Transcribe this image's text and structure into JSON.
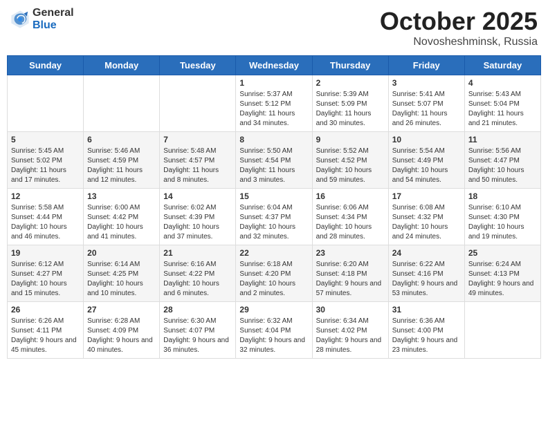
{
  "header": {
    "logo_general": "General",
    "logo_blue": "Blue",
    "month": "October 2025",
    "location": "Novosheshminsk, Russia"
  },
  "weekdays": [
    "Sunday",
    "Monday",
    "Tuesday",
    "Wednesday",
    "Thursday",
    "Friday",
    "Saturday"
  ],
  "weeks": [
    [
      {
        "day": "",
        "info": ""
      },
      {
        "day": "",
        "info": ""
      },
      {
        "day": "",
        "info": ""
      },
      {
        "day": "1",
        "info": "Sunrise: 5:37 AM\nSunset: 5:12 PM\nDaylight: 11 hours\nand 34 minutes."
      },
      {
        "day": "2",
        "info": "Sunrise: 5:39 AM\nSunset: 5:09 PM\nDaylight: 11 hours\nand 30 minutes."
      },
      {
        "day": "3",
        "info": "Sunrise: 5:41 AM\nSunset: 5:07 PM\nDaylight: 11 hours\nand 26 minutes."
      },
      {
        "day": "4",
        "info": "Sunrise: 5:43 AM\nSunset: 5:04 PM\nDaylight: 11 hours\nand 21 minutes."
      }
    ],
    [
      {
        "day": "5",
        "info": "Sunrise: 5:45 AM\nSunset: 5:02 PM\nDaylight: 11 hours\nand 17 minutes."
      },
      {
        "day": "6",
        "info": "Sunrise: 5:46 AM\nSunset: 4:59 PM\nDaylight: 11 hours\nand 12 minutes."
      },
      {
        "day": "7",
        "info": "Sunrise: 5:48 AM\nSunset: 4:57 PM\nDaylight: 11 hours\nand 8 minutes."
      },
      {
        "day": "8",
        "info": "Sunrise: 5:50 AM\nSunset: 4:54 PM\nDaylight: 11 hours\nand 3 minutes."
      },
      {
        "day": "9",
        "info": "Sunrise: 5:52 AM\nSunset: 4:52 PM\nDaylight: 10 hours\nand 59 minutes."
      },
      {
        "day": "10",
        "info": "Sunrise: 5:54 AM\nSunset: 4:49 PM\nDaylight: 10 hours\nand 54 minutes."
      },
      {
        "day": "11",
        "info": "Sunrise: 5:56 AM\nSunset: 4:47 PM\nDaylight: 10 hours\nand 50 minutes."
      }
    ],
    [
      {
        "day": "12",
        "info": "Sunrise: 5:58 AM\nSunset: 4:44 PM\nDaylight: 10 hours\nand 46 minutes."
      },
      {
        "day": "13",
        "info": "Sunrise: 6:00 AM\nSunset: 4:42 PM\nDaylight: 10 hours\nand 41 minutes."
      },
      {
        "day": "14",
        "info": "Sunrise: 6:02 AM\nSunset: 4:39 PM\nDaylight: 10 hours\nand 37 minutes."
      },
      {
        "day": "15",
        "info": "Sunrise: 6:04 AM\nSunset: 4:37 PM\nDaylight: 10 hours\nand 32 minutes."
      },
      {
        "day": "16",
        "info": "Sunrise: 6:06 AM\nSunset: 4:34 PM\nDaylight: 10 hours\nand 28 minutes."
      },
      {
        "day": "17",
        "info": "Sunrise: 6:08 AM\nSunset: 4:32 PM\nDaylight: 10 hours\nand 24 minutes."
      },
      {
        "day": "18",
        "info": "Sunrise: 6:10 AM\nSunset: 4:30 PM\nDaylight: 10 hours\nand 19 minutes."
      }
    ],
    [
      {
        "day": "19",
        "info": "Sunrise: 6:12 AM\nSunset: 4:27 PM\nDaylight: 10 hours\nand 15 minutes."
      },
      {
        "day": "20",
        "info": "Sunrise: 6:14 AM\nSunset: 4:25 PM\nDaylight: 10 hours\nand 10 minutes."
      },
      {
        "day": "21",
        "info": "Sunrise: 6:16 AM\nSunset: 4:22 PM\nDaylight: 10 hours\nand 6 minutes."
      },
      {
        "day": "22",
        "info": "Sunrise: 6:18 AM\nSunset: 4:20 PM\nDaylight: 10 hours\nand 2 minutes."
      },
      {
        "day": "23",
        "info": "Sunrise: 6:20 AM\nSunset: 4:18 PM\nDaylight: 9 hours\nand 57 minutes."
      },
      {
        "day": "24",
        "info": "Sunrise: 6:22 AM\nSunset: 4:16 PM\nDaylight: 9 hours\nand 53 minutes."
      },
      {
        "day": "25",
        "info": "Sunrise: 6:24 AM\nSunset: 4:13 PM\nDaylight: 9 hours\nand 49 minutes."
      }
    ],
    [
      {
        "day": "26",
        "info": "Sunrise: 6:26 AM\nSunset: 4:11 PM\nDaylight: 9 hours\nand 45 minutes."
      },
      {
        "day": "27",
        "info": "Sunrise: 6:28 AM\nSunset: 4:09 PM\nDaylight: 9 hours\nand 40 minutes."
      },
      {
        "day": "28",
        "info": "Sunrise: 6:30 AM\nSunset: 4:07 PM\nDaylight: 9 hours\nand 36 minutes."
      },
      {
        "day": "29",
        "info": "Sunrise: 6:32 AM\nSunset: 4:04 PM\nDaylight: 9 hours\nand 32 minutes."
      },
      {
        "day": "30",
        "info": "Sunrise: 6:34 AM\nSunset: 4:02 PM\nDaylight: 9 hours\nand 28 minutes."
      },
      {
        "day": "31",
        "info": "Sunrise: 6:36 AM\nSunset: 4:00 PM\nDaylight: 9 hours\nand 23 minutes."
      },
      {
        "day": "",
        "info": ""
      }
    ]
  ]
}
